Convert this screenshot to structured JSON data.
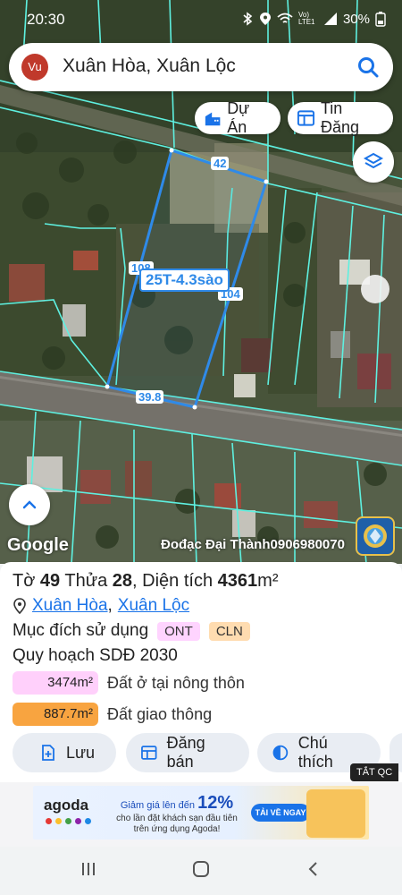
{
  "status_bar": {
    "time": "20:30",
    "battery": "30%",
    "network": "Vo) LTE1"
  },
  "search": {
    "avatar_initials": "Vu",
    "query": "Xuân Hòa, Xuân Lộc"
  },
  "chips": {
    "du_an": "Dự Án",
    "tin_dang": "Tin Đăng"
  },
  "map": {
    "plot_label": "25T-4.3sào",
    "edge_top": "42",
    "edge_left": "108",
    "edge_right": "104",
    "edge_bottom": "39.8",
    "google": "Google",
    "watermark": "Đođạc Đại Thành0906980070"
  },
  "parcel": {
    "sheet_prefix": "Tờ",
    "sheet_no": "49",
    "parcel_prefix": "Thửa",
    "parcel_no": "28",
    "area_prefix": "Diện tích",
    "area_value": "4361",
    "area_unit": "m²",
    "location_1": "Xuân Hòa",
    "location_2": "Xuân Lộc",
    "location_sep": ",",
    "purpose_label": "Mục đích sử dụng",
    "purpose_tags": [
      "ONT",
      "CLN"
    ],
    "planning": "Quy hoạch SDĐ 2030",
    "areas": [
      {
        "value": "3474m²",
        "label": "Đất ở tại nông thôn",
        "color": "#ffd0fb"
      },
      {
        "value": "887.7m²",
        "label": "Đất giao thông",
        "color": "#f8a440"
      }
    ]
  },
  "actions": {
    "save": "Lưu",
    "sell": "Đăng bán",
    "legend": "Chú thích"
  },
  "ad": {
    "off_label": "TẮT QC",
    "brand": "agoda",
    "headline_pre": "Giảm giá lên đến",
    "headline_pct": "12%",
    "sub": "cho lần đặt khách sạn đầu tiên trên ứng dụng Agoda!",
    "cta": "TẢI VỀ NGAY"
  },
  "colors": {
    "plot_outline": "#2f8ae8",
    "parcel_lines": "#5ef0e0",
    "link": "#1a73e8"
  }
}
